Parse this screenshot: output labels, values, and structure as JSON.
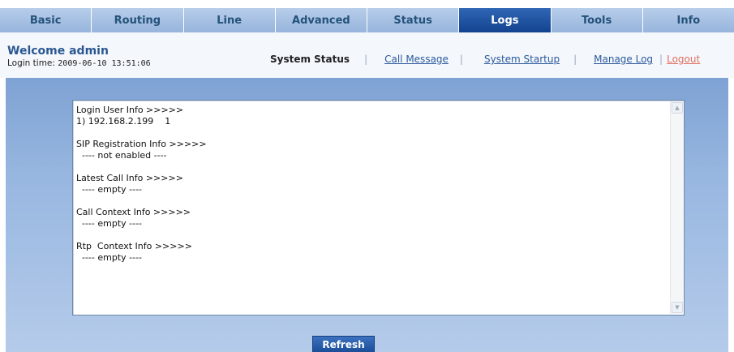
{
  "nav": {
    "tabs": [
      {
        "label": "Basic"
      },
      {
        "label": "Routing"
      },
      {
        "label": "Line"
      },
      {
        "label": "Advanced"
      },
      {
        "label": "Status"
      },
      {
        "label": "Logs"
      },
      {
        "label": "Tools"
      },
      {
        "label": "Info"
      }
    ],
    "active": "Logs"
  },
  "header": {
    "welcome": "Welcome admin",
    "login_time_label": "Login time:",
    "login_time_value": "2009-06-10 13:51:06"
  },
  "sublinks": {
    "current": "System Status",
    "call_message": "Call Message",
    "system_startup": "System Startup",
    "manage_log": "Manage Log",
    "logout": "Logout",
    "separator": "|"
  },
  "log": {
    "text": "Login User Info >>>>>\n1) 192.168.2.199    1\n\nSIP Registration Info >>>>>\n  ---- not enabled ----\n\nLatest Call Info >>>>>\n  ---- empty ----\n\nCall Context Info >>>>>\n  ---- empty ----\n\nRtp  Context Info >>>>>\n  ---- empty ----"
  },
  "actions": {
    "refresh_label": "Refresh"
  },
  "icons": {
    "scroll_up": "chevron-up-icon",
    "scroll_down": "chevron-down-icon"
  },
  "colors": {
    "nav_active": "#1f55a4",
    "accent": "#2a5791",
    "logout": "#e07060"
  }
}
